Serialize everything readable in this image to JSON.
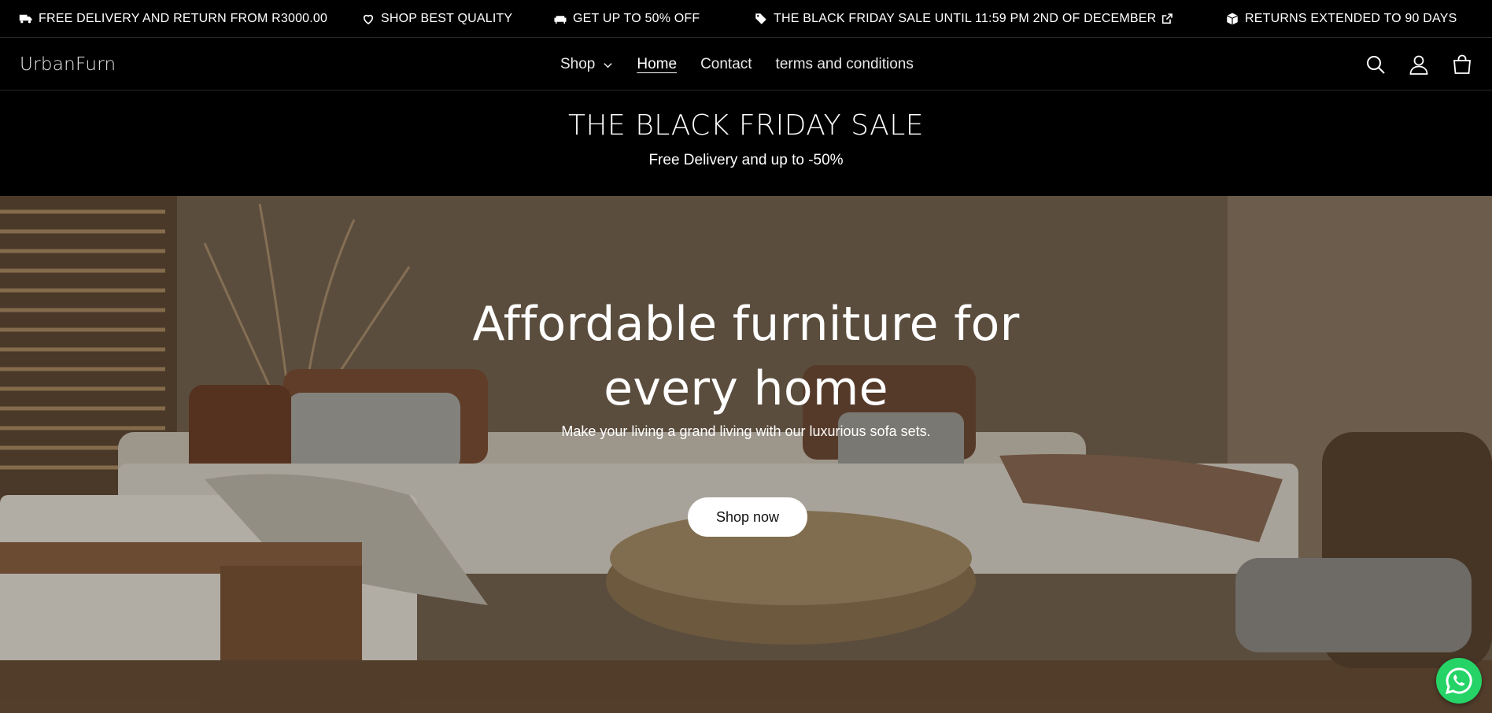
{
  "announcements": [
    {
      "icon": "truck-icon",
      "text": "FREE DELIVERY AND RETURN FROM R3000.00"
    },
    {
      "icon": "heart-icon",
      "text": "SHOP BEST QUALITY"
    },
    {
      "icon": "sofa-icon",
      "text": "GET UP TO 50% OFF"
    },
    {
      "icon": "tag-icon",
      "text": "THE BLACK FRIDAY SALE UNTIL 11:59 PM 2ND OF DECEMBER",
      "trailing_icon": "external-link-icon"
    },
    {
      "icon": "box-icon",
      "text": "RETURNS EXTENDED TO 90 DAYS"
    }
  ],
  "header": {
    "logo": "UrbanFurn",
    "nav": [
      {
        "label": "Shop",
        "has_dropdown": true
      },
      {
        "label": "Home",
        "active": true
      },
      {
        "label": "Contact"
      },
      {
        "label": "terms and conditions"
      }
    ],
    "icons": [
      "search-icon",
      "account-icon",
      "cart-icon"
    ]
  },
  "sale_banner": {
    "title": "THE BLACK FRIDAY SALE",
    "subtitle": "Free Delivery and up to -50%"
  },
  "hero": {
    "title_line1": "Affordable furniture for",
    "title_line2": "every home",
    "subtitle": "Make your living a grand living with our luxurious sofa sets.",
    "button": "Shop now"
  },
  "floating": {
    "icon": "whatsapp-icon"
  },
  "colors": {
    "background": "#000000",
    "text": "#ffffff",
    "button_bg": "#ffffff",
    "whatsapp": "#25d366"
  }
}
